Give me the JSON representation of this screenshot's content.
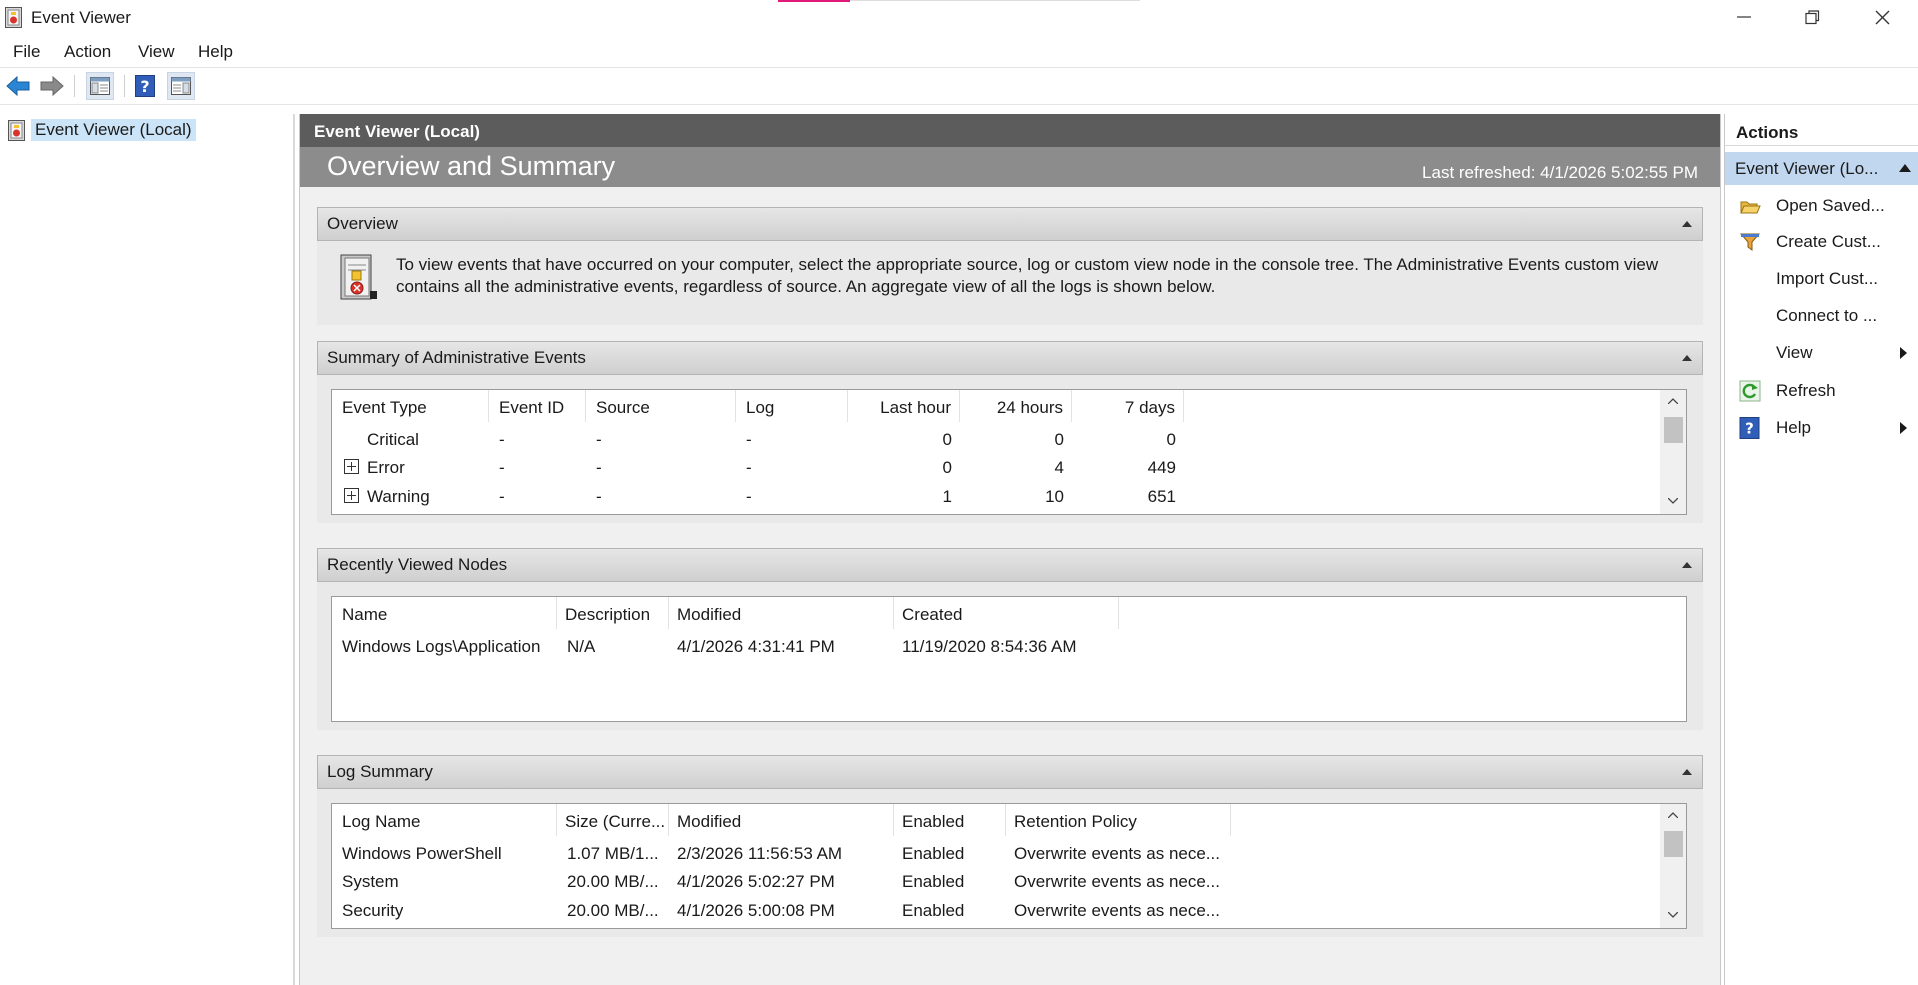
{
  "window": {
    "title": "Event Viewer"
  },
  "menu": [
    "File",
    "Action",
    "View",
    "Help"
  ],
  "tree": {
    "root_label": "Event Viewer (Local)"
  },
  "center": {
    "header": "Event Viewer (Local)",
    "banner_title": "Overview and Summary",
    "last_refreshed": "Last refreshed: 4/1/2026 5:02:55 PM",
    "overview": {
      "title": "Overview",
      "text": "To view events that have occurred on your computer, select the appropriate source, log or custom view node in the console tree. The Administrative Events custom view contains all the administrative events, regardless of source. An aggregate view of all the logs is shown below."
    },
    "summary": {
      "title": "Summary of Administrative Events",
      "columns": [
        "Event Type",
        "Event ID",
        "Source",
        "Log",
        "Last hour",
        "24 hours",
        "7 days"
      ],
      "rows": [
        {
          "type": "Critical",
          "event_id": "-",
          "source": "-",
          "log": "-",
          "last_hour": "0",
          "h24": "0",
          "d7": "0",
          "expandable": false
        },
        {
          "type": "Error",
          "event_id": "-",
          "source": "-",
          "log": "-",
          "last_hour": "0",
          "h24": "4",
          "d7": "449",
          "expandable": true
        },
        {
          "type": "Warning",
          "event_id": "-",
          "source": "-",
          "log": "-",
          "last_hour": "1",
          "h24": "10",
          "d7": "651",
          "expandable": true
        }
      ]
    },
    "recent": {
      "title": "Recently Viewed Nodes",
      "columns": [
        "Name",
        "Description",
        "Modified",
        "Created"
      ],
      "rows": [
        {
          "name": "Windows Logs\\Application",
          "description": "N/A",
          "modified": "4/1/2026 4:31:41 PM",
          "created": "11/19/2020 8:54:36 AM"
        }
      ]
    },
    "logsummary": {
      "title": "Log Summary",
      "columns": [
        "Log Name",
        "Size (Curre...",
        "Modified",
        "Enabled",
        "Retention Policy"
      ],
      "rows": [
        {
          "name": "Windows PowerShell",
          "size": "1.07 MB/1...",
          "modified": "2/3/2026 11:56:53 AM",
          "enabled": "Enabled",
          "retention": "Overwrite events as nece..."
        },
        {
          "name": "System",
          "size": "20.00 MB/...",
          "modified": "4/1/2026 5:02:27 PM",
          "enabled": "Enabled",
          "retention": "Overwrite events as nece..."
        },
        {
          "name": "Security",
          "size": "20.00 MB/...",
          "modified": "4/1/2026 5:00:08 PM",
          "enabled": "Enabled",
          "retention": "Overwrite events as nece..."
        }
      ]
    }
  },
  "actions": {
    "title": "Actions",
    "group": "Event Viewer (Lo...",
    "items": [
      {
        "label": "Open Saved...",
        "icon": "folder-open-icon",
        "submenu": false
      },
      {
        "label": "Create Cust...",
        "icon": "filter-icon",
        "submenu": false
      },
      {
        "label": "Import Cust...",
        "icon": "",
        "submenu": false
      },
      {
        "label": "Connect to ...",
        "icon": "",
        "submenu": false
      },
      {
        "label": "View",
        "icon": "",
        "submenu": true
      },
      {
        "label": "Refresh",
        "icon": "refresh-icon",
        "submenu": false
      },
      {
        "label": "Help",
        "icon": "help-icon",
        "submenu": true
      }
    ]
  },
  "colors": {
    "header_dark": "#5c5c5c",
    "banner": "#8c8c8c",
    "selection": "#cce4f7",
    "actions_group": "#c1d7ef",
    "accent_pink": "#e0197b"
  }
}
